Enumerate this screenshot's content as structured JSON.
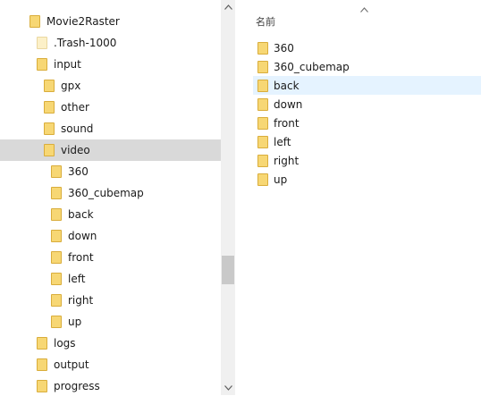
{
  "tree": {
    "items": [
      {
        "label": "Movie2Raster"
      },
      {
        "label": ".Trash-1000"
      },
      {
        "label": "input"
      },
      {
        "label": "gpx"
      },
      {
        "label": "other"
      },
      {
        "label": "sound"
      },
      {
        "label": "video"
      },
      {
        "label": "360"
      },
      {
        "label": "360_cubemap"
      },
      {
        "label": "back"
      },
      {
        "label": "down"
      },
      {
        "label": "front"
      },
      {
        "label": "left"
      },
      {
        "label": "right"
      },
      {
        "label": "up"
      },
      {
        "label": "logs"
      },
      {
        "label": "output"
      },
      {
        "label": "progress"
      }
    ],
    "selected": "video"
  },
  "content": {
    "column_header": "名前",
    "items": [
      {
        "label": "360"
      },
      {
        "label": "360_cubemap"
      },
      {
        "label": "back"
      },
      {
        "label": "down"
      },
      {
        "label": "front"
      },
      {
        "label": "left"
      },
      {
        "label": "right"
      },
      {
        "label": "up"
      }
    ],
    "hovered": "back"
  },
  "icons": {
    "folder": "folder-icon",
    "scroll_up": "chevron-up-icon",
    "scroll_down": "chevron-down-icon",
    "sort": "chevron-up-icon"
  },
  "colors": {
    "folder": "#f7d774",
    "selection": "#d9d9d9",
    "hover": "#e5f3ff"
  }
}
